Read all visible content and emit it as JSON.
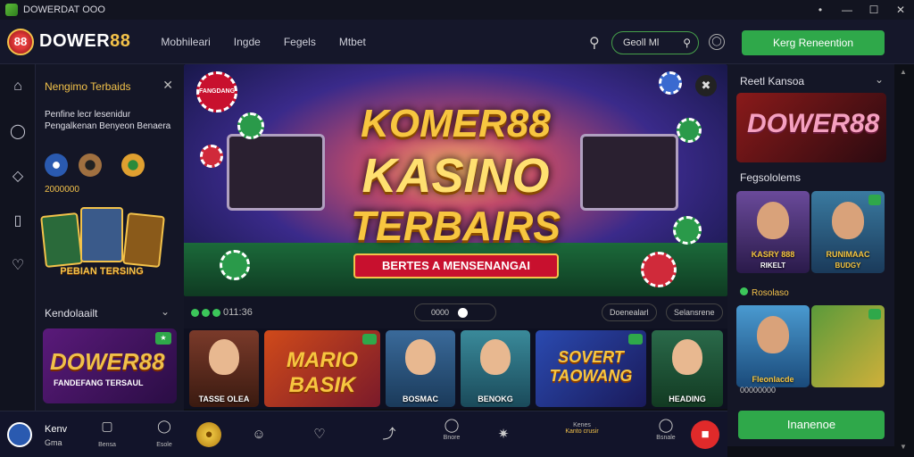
{
  "window": {
    "title": "DOWERDAT OOO",
    "controls": [
      "•",
      "—",
      "☐",
      "✕"
    ]
  },
  "header": {
    "logo_badge": "88",
    "logo_text": "DOWER",
    "logo_text_hl": "88",
    "nav": [
      "Mobhileari",
      "Ingde",
      "Fegels",
      "Mtbet"
    ],
    "search_value": "Geoll Ml",
    "cta_label": "Kerg Reneention"
  },
  "sidebar": {
    "icons": [
      "home-icon",
      "chat-icon",
      "tag-icon",
      "book-icon",
      "heart-icon"
    ]
  },
  "left_panel": {
    "title": "Nengimo Terbaids",
    "description": "Penfine lecr lesenidur Pengalkenan Benyeon Benaera",
    "count": "2000000",
    "banner": "PEBIAN TERSING",
    "section2_title": "Kendolaailt",
    "promo_title": "DOWER88",
    "promo_subtitle": "FANDEFANG TERSAUL"
  },
  "hero": {
    "stamp": "FANGDANG",
    "line1": "KOMER88",
    "line2": "KASINO",
    "line3": "TERBAIRS",
    "ribbon": "BERTES A MENSENANGAI"
  },
  "row_controls": {
    "dots_text": "011:36",
    "toggle_text": "0000",
    "pill1": "Doenealarl",
    "pill2": "Selansrene"
  },
  "games": [
    {
      "label": "TASSE OLEA",
      "big": ""
    },
    {
      "label": "",
      "big": "MARIO BASIK"
    },
    {
      "label": "BOSMAC",
      "big": ""
    },
    {
      "label": "BENOKG",
      "big": ""
    },
    {
      "label": "",
      "big": "SOVERT TAOWANG"
    },
    {
      "label": "HEADING",
      "big": ""
    }
  ],
  "right_panel": {
    "title1": "Reetl Kansoa",
    "promo_title": "DOWER88",
    "title2": "Fegsololems",
    "card1_label": "KASRY 888",
    "card1_sub": "RIKELT",
    "card2_label": "RUNIMAAC",
    "card2_sub": "BUDGY",
    "dot_label": "Rosolaso",
    "card3_label": "Fleonlacde",
    "card4_label": "",
    "count": "00000000",
    "cta_label": "Inanenoe"
  },
  "bottom": {
    "user_name": "Kenv",
    "user_balance": "Gma",
    "items": [
      {
        "label": "Bensa",
        "icon": "bag-icon"
      },
      {
        "label": "Esole",
        "icon": "chat-icon"
      }
    ],
    "dock_labels": {
      "d5": "Bnore",
      "d7a": "Kenes",
      "d7b": "Kanto crusir",
      "d8": "Bsnale"
    }
  }
}
